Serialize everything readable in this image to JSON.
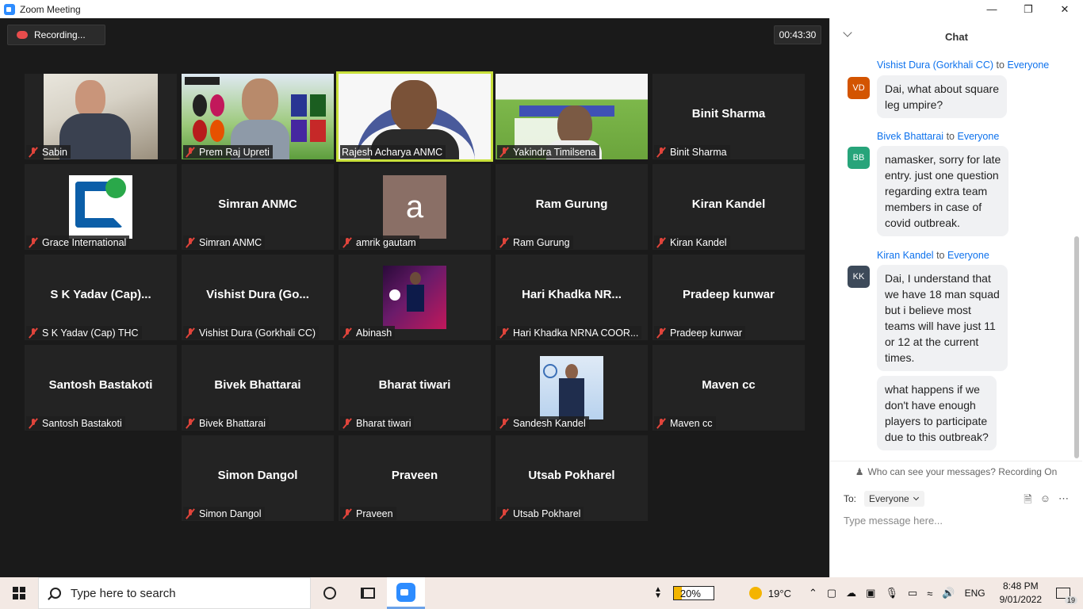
{
  "window": {
    "title": "Zoom Meeting"
  },
  "meeting": {
    "recording_label": "Recording...",
    "timer": "00:43:30",
    "tiles": [
      {
        "name": "Sabin",
        "type": "video"
      },
      {
        "name": "Prem Raj Upreti",
        "type": "video"
      },
      {
        "name": "Rajesh Acharya ANMC",
        "type": "video",
        "active": true
      },
      {
        "name": "Yakindra Timilsena",
        "type": "video"
      },
      {
        "name": "Binit Sharma",
        "display": "Binit Sharma",
        "type": "name"
      },
      {
        "name": "Grace International",
        "type": "logo"
      },
      {
        "name": "Simran ANMC",
        "display": "Simran ANMC",
        "type": "name"
      },
      {
        "name": "amrik gautam",
        "type": "avatar",
        "letter": "a"
      },
      {
        "name": "Ram Gurung",
        "display": "Ram Gurung",
        "type": "name"
      },
      {
        "name": "Kiran Kandel",
        "display": "Kiran Kandel",
        "type": "name"
      },
      {
        "name": "S K Yadav (Cap) THC",
        "display": "S K Yadav (Cap)...",
        "type": "name"
      },
      {
        "name": "Vishist Dura (Gorkhali CC)",
        "display": "Vishist Dura (Go...",
        "type": "name"
      },
      {
        "name": "Abinash",
        "type": "photo"
      },
      {
        "name": "Hari Khadka NRNA COOR...",
        "display": "Hari Khadka NR...",
        "type": "name"
      },
      {
        "name": "Pradeep kunwar",
        "display": "Pradeep kunwar",
        "type": "name"
      },
      {
        "name": "Santosh Bastakoti",
        "display": "Santosh Bastakoti",
        "type": "name"
      },
      {
        "name": "Bivek Bhattarai",
        "display": "Bivek Bhattarai",
        "type": "name"
      },
      {
        "name": "Bharat tiwari",
        "display": "Bharat tiwari",
        "type": "name"
      },
      {
        "name": "Sandesh Kandel",
        "type": "photo2"
      },
      {
        "name": "Maven cc",
        "display": "Maven cc",
        "type": "name"
      },
      {
        "name": "Simon Dangol",
        "display": "Simon Dangol",
        "type": "name"
      },
      {
        "name": "Praveen",
        "display": "Praveen",
        "type": "name"
      },
      {
        "name": "Utsab Pokharel",
        "display": "Utsab Pokharel",
        "type": "name"
      }
    ]
  },
  "chat": {
    "title": "Chat",
    "messages": [
      {
        "sender": "Vishist Dura (Gorkhali CC)",
        "to_word": "to",
        "recipient": "Everyone",
        "initials": "VD",
        "color": "#d35400",
        "lines": [
          "Dai, what about square",
          "leg umpire?"
        ]
      },
      {
        "sender": "Bivek Bhattarai",
        "to_word": "to",
        "recipient": "Everyone",
        "initials": "BB",
        "color": "#27a47a",
        "lines": [
          "namasker, sorry for late",
          "entry. just one question",
          "regarding extra team",
          "members in case of",
          "covid outbreak."
        ]
      },
      {
        "sender": "Kiran Kandel",
        "to_word": "to",
        "recipient": "Everyone",
        "initials": "KK",
        "color": "#3d4a5a",
        "lines": [
          "Dai, I understand that",
          "we have 18 man squad",
          "but i believe most",
          "teams will have just 11",
          "or 12 at the current",
          "times."
        ]
      },
      {
        "sender": "",
        "lines": [
          "what happens if we",
          "don't have enough",
          "players to participate",
          "due to this outbreak?"
        ]
      }
    ],
    "visibility_note": "Who can see your messages? Recording On",
    "to_label": "To:",
    "recipient_select": "Everyone",
    "input_placeholder": "Type message here..."
  },
  "taskbar": {
    "search_placeholder": "Type here to search",
    "battery": "20%",
    "battery_level": 0.2,
    "temperature": "19°C",
    "language": "ENG",
    "time": "8:48 PM",
    "date": "9/01/2022",
    "notification_count": "19"
  }
}
